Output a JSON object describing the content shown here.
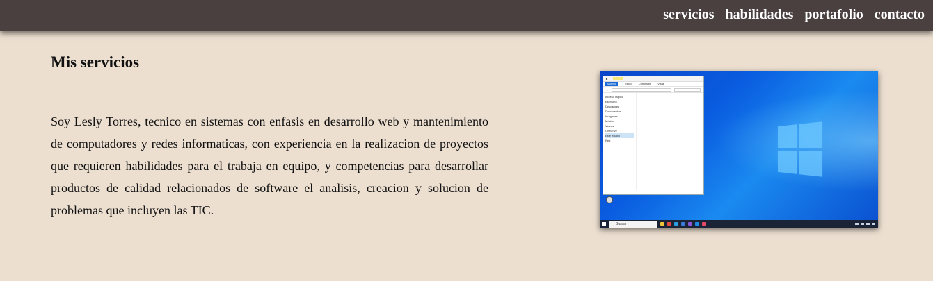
{
  "nav": {
    "items": [
      "servicios",
      "habilidades",
      "portafolio",
      "contacto"
    ]
  },
  "services": {
    "title": "Mis servicios",
    "description": "Soy Lesly Torres, tecnico en sistemas con enfasis en desarrollo web y mantenimiento de computadores y redes informaticas, con experiencia en la realizacion de proyectos que requieren habilidades para el trabaja en equipo, y competencias para desarrollar productos de calidad relacionados de software el analisis, creacion y solucion de problemas que incluyen las TIC."
  },
  "screenshot_image": {
    "icon": "windows-desktop-screenshot",
    "explorer": {
      "tabs": [
        "Archivo",
        "Inicio",
        "Compartir",
        "Vista"
      ],
      "sidebar": [
        "Acceso rápido",
        "Escritorio",
        "Descargas",
        "Documentos",
        "Imágenes",
        "Música",
        "Videos",
        "OneDrive",
        "Este equipo",
        "Red"
      ]
    },
    "taskbar_search": "Buscar"
  },
  "colors": {
    "background": "#ecdfd0",
    "topbar": "#4a4040",
    "nav_text": "#ffffff"
  }
}
